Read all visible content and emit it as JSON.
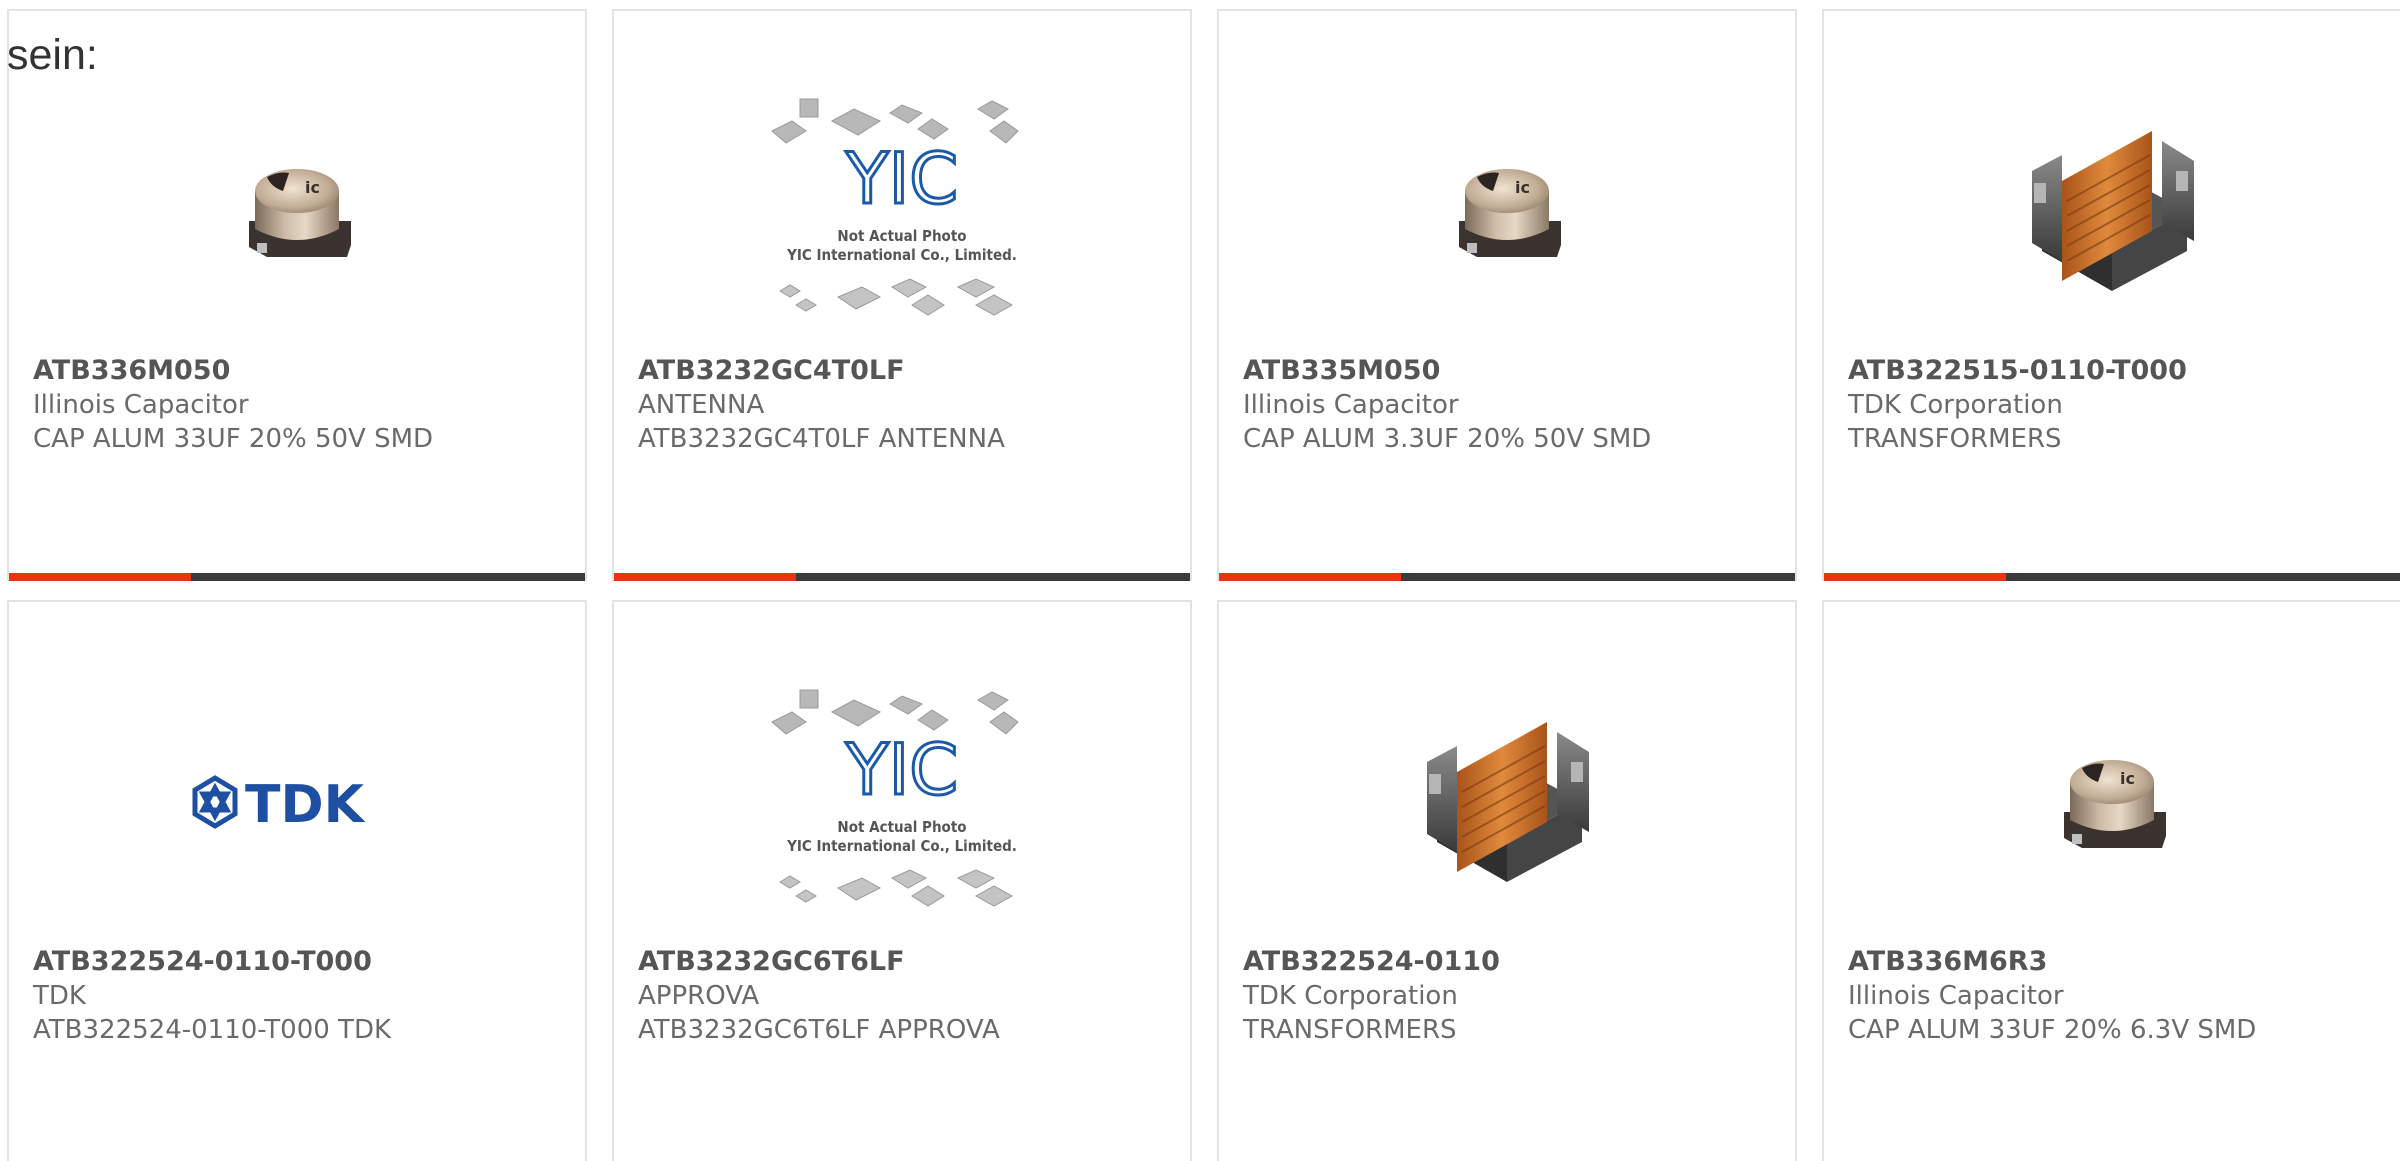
{
  "page": {
    "heading": "sein:"
  },
  "colors": {
    "accent_bar": "#e8340f",
    "bar_dark": "#3b3b3b",
    "card_border": "#e3e3e3",
    "tdk_blue": "#1d4fa3"
  },
  "products": [
    {
      "part_number": "ATB336M050",
      "manufacturer": "Illinois Capacitor",
      "description": "CAP ALUM 33UF 20% 50V SMD",
      "image": "capacitor-image"
    },
    {
      "part_number": "ATB3232GC4T0LF",
      "manufacturer": "ANTENNA",
      "description": "ATB3232GC4T0LF ANTENNA",
      "image": "yic-placeholder-image"
    },
    {
      "part_number": "ATB335M050",
      "manufacturer": "Illinois Capacitor",
      "description": "CAP ALUM 3.3UF 20% 50V SMD",
      "image": "capacitor-image"
    },
    {
      "part_number": "ATB322515-0110-T000",
      "manufacturer": "TDK Corporation",
      "description": "TRANSFORMERS",
      "image": "transformer-image"
    },
    {
      "part_number": "ATB322524-0110-T000",
      "manufacturer": "TDK",
      "description": "ATB322524-0110-T000 TDK",
      "image": "tdk-logo-image"
    },
    {
      "part_number": "ATB3232GC6T6LF",
      "manufacturer": "APPROVA",
      "description": "ATB3232GC6T6LF APPROVA",
      "image": "yic-placeholder-image"
    },
    {
      "part_number": "ATB322524-0110",
      "manufacturer": "TDK Corporation",
      "description": "TRANSFORMERS",
      "image": "transformer-image"
    },
    {
      "part_number": "ATB336M6R3",
      "manufacturer": "Illinois Capacitor",
      "description": "CAP ALUM 33UF 20% 6.3V SMD",
      "image": "capacitor-image"
    }
  ],
  "yic_placeholder": {
    "logo_text": "YIC",
    "line1": "Not Actual Photo",
    "line2": "YIC International Co., Limited."
  },
  "tdk_logo": {
    "text": "TDK"
  },
  "capacitor_marking": "ic"
}
